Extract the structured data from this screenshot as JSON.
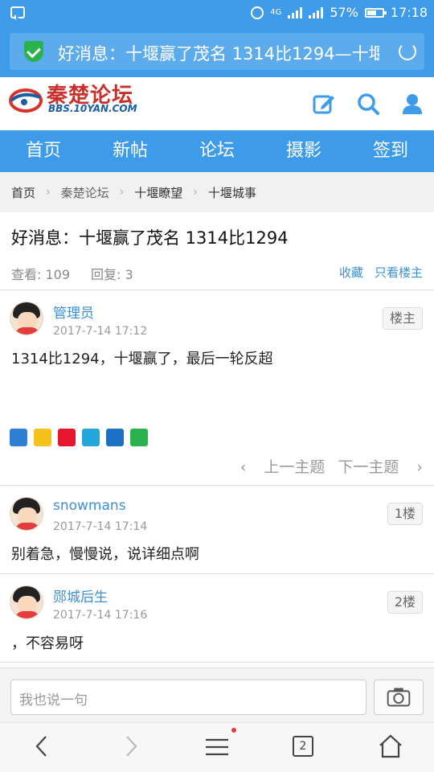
{
  "status_bar": {
    "network": "4G",
    "battery": "57%",
    "battery_level": 0.57,
    "time": "17:18"
  },
  "address_bar": {
    "page_title": "好消息：十堰赢了茂名 1314比1294—十堰",
    "secure_icon": "shield-check-icon",
    "reload_icon": "refresh-icon"
  },
  "site": {
    "name": "秦楚论坛",
    "url": "BBS.10YAN.COM",
    "brand_color": "#c9302c",
    "accent_color": "#3d9be9"
  },
  "nav": [
    "首页",
    "新帖",
    "论坛",
    "摄影",
    "签到"
  ],
  "breadcrumb": [
    "首页",
    "秦楚论坛",
    "十堰瞭望",
    "十堰城事"
  ],
  "thread": {
    "title": "好消息：十堰赢了茂名 1314比1294",
    "views": "查看: 109",
    "replies": "回复: 3",
    "favorite": "收藏",
    "only_op": "只看楼主"
  },
  "posts": [
    {
      "author": "管理员",
      "time": "2017-7-14 17:12",
      "badge": "楼主",
      "content": "1314比1294，十堰赢了，最后一轮反超"
    },
    {
      "author": "snowmans",
      "time": "2017-7-14 17:14",
      "badge": "1楼",
      "content": "别着急，慢慢说，说详细点啊"
    },
    {
      "author": "郧城后生",
      "time": "2017-7-14 17:16",
      "badge": "2楼",
      "content": "，不容易呀"
    }
  ],
  "share_icons": [
    "qzone-plus-icon",
    "qzone-star-icon",
    "weibo-icon",
    "tencent-weibo-icon",
    "renren-icon",
    "wechat-icon"
  ],
  "pager": {
    "prev": "上一主题",
    "next": "下一主题"
  },
  "compose": {
    "placeholder": "我也说一句"
  },
  "browser_toolbar": {
    "tabs_count": "2"
  }
}
